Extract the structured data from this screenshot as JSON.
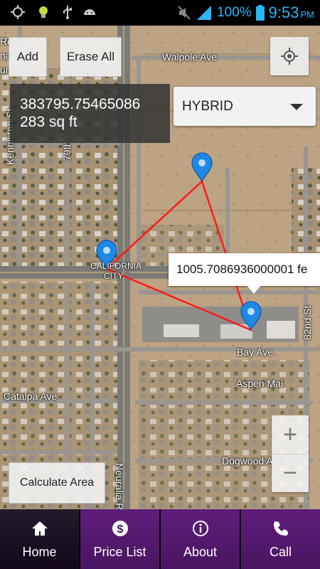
{
  "status_bar": {
    "battery_percent": "100%",
    "time": "9:53",
    "ampm": "PM",
    "icons": [
      "gps-icon",
      "bulb-icon",
      "usb-icon",
      "android-icon",
      "mute-icon",
      "signal-icon",
      "battery-icon"
    ]
  },
  "map": {
    "buttons": {
      "add": "Add",
      "erase_all": "Erase All",
      "calculate_area": "Calculate Area"
    },
    "area": {
      "value": "383795.75465086",
      "sq_ft": "283 sq ft"
    },
    "map_type": {
      "selected": "HYBRID"
    },
    "zoom": {
      "in": "+",
      "out": "−"
    },
    "tooltip": "1005.7086936000001 fe",
    "streets": {
      "walpole": "Walpole Ave",
      "kenniston": "Kenniston St",
      "seventy_ninth": "79th St",
      "california_city_1": "CALIFORNIA",
      "california_city_2": "CITY",
      "eighty_second": "82nd St",
      "bay": "Bay Ave",
      "aspen": "Aspen Mal",
      "catalpa": "Catalpa Ave",
      "neuralia": "Neuralia Rd",
      "dogwood": "Dogwood Ave",
      "rock": "Rock",
      "na": "na",
      "ur": "ur"
    },
    "line_color": "#ff1a1a",
    "marker_color": "#1e88e5"
  },
  "nav": {
    "items": [
      {
        "label": "Home",
        "icon": "home-icon"
      },
      {
        "label": "Price List",
        "icon": "dollar-icon"
      },
      {
        "label": "About",
        "icon": "info-icon"
      },
      {
        "label": "Call",
        "icon": "phone-icon"
      }
    ]
  }
}
